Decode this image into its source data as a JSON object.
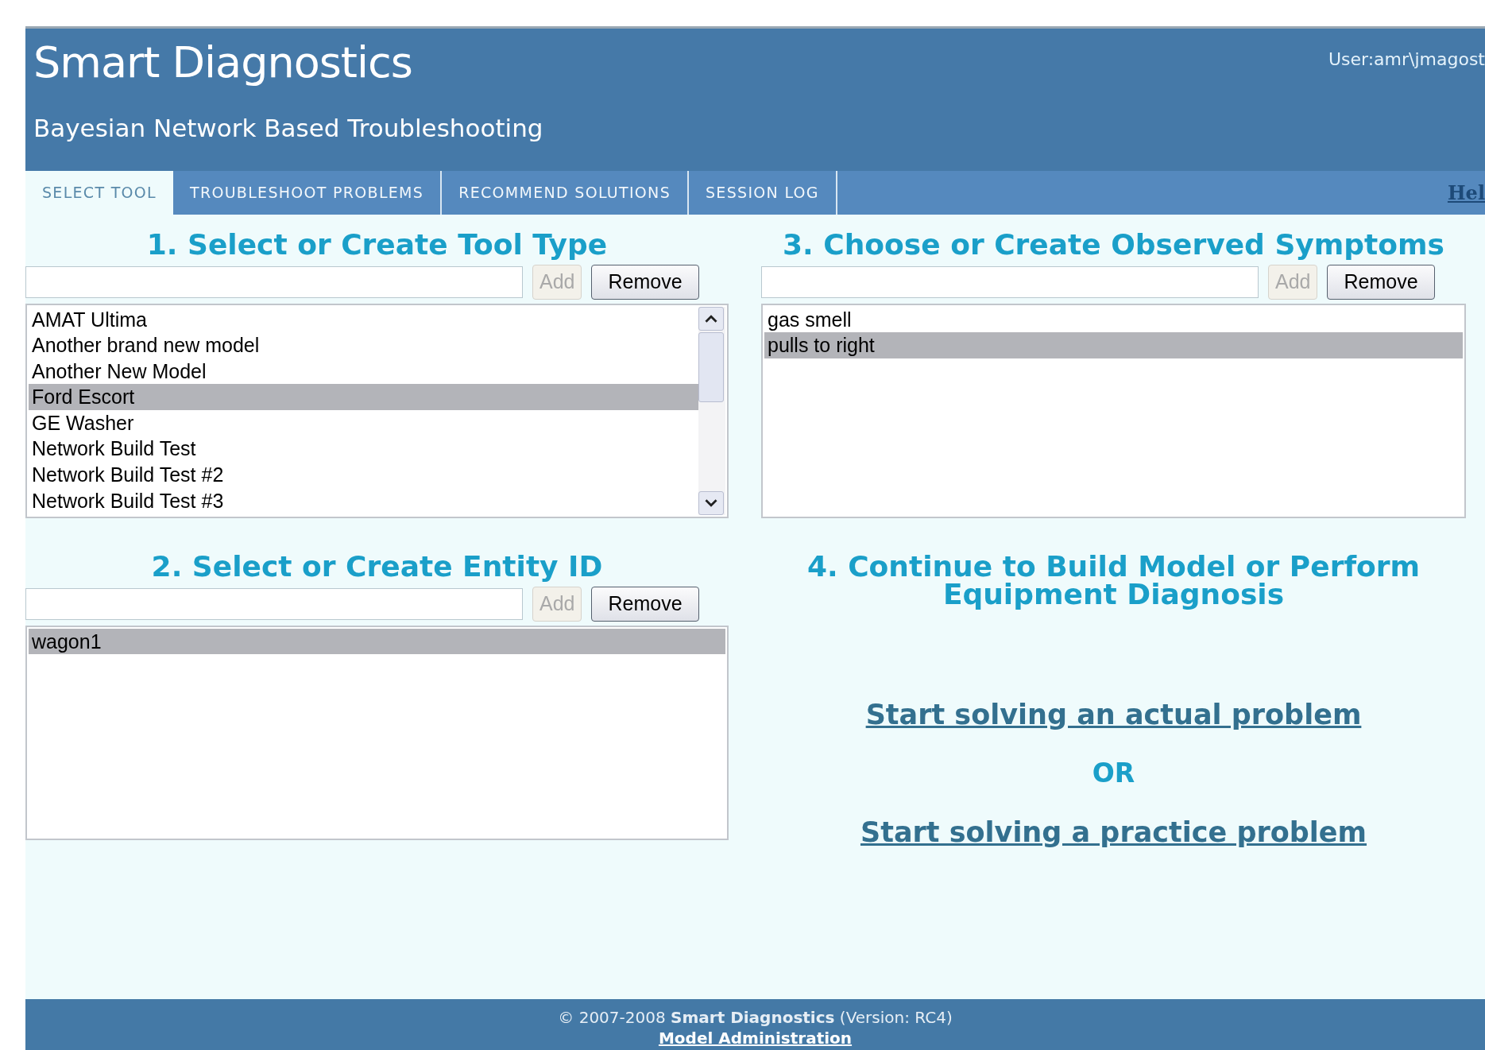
{
  "header": {
    "title": "Smart Diagnostics",
    "subtitle": "Bayesian Network Based Troubleshooting",
    "user": "User:amr\\jmagost"
  },
  "tabs": [
    {
      "label": "SELECT TOOL",
      "selected": true
    },
    {
      "label": "TROUBLESHOOT PROBLEMS",
      "selected": false
    },
    {
      "label": "RECOMMEND SOLUTIONS",
      "selected": false
    },
    {
      "label": "SESSION LOG",
      "selected": false
    }
  ],
  "help_link": "Hel",
  "panels": [
    {
      "kind": "picker",
      "heading": "1. Select or Create Tool Type",
      "add_button": {
        "label": "Add",
        "disabled": true
      },
      "remove_button": {
        "label": "Remove",
        "disabled": false
      },
      "scrollbar": true,
      "items": [
        {
          "label": "AMAT Ultima",
          "selected": false
        },
        {
          "label": "Another brand new model",
          "selected": false
        },
        {
          "label": "Another New Model",
          "selected": false
        },
        {
          "label": "Ford Escort",
          "selected": true
        },
        {
          "label": "GE Washer",
          "selected": false
        },
        {
          "label": "Network Build Test",
          "selected": false
        },
        {
          "label": "Network Build Test #2",
          "selected": false
        },
        {
          "label": "Network Build Test #3",
          "selected": false
        }
      ]
    },
    {
      "kind": "picker",
      "heading": "3. Choose or Create Observed Symptoms",
      "add_button": {
        "label": "Add",
        "disabled": true
      },
      "remove_button": {
        "label": "Remove",
        "disabled": false
      },
      "scrollbar": false,
      "items": [
        {
          "label": "gas smell",
          "selected": false
        },
        {
          "label": "pulls to right",
          "selected": true
        }
      ]
    },
    {
      "kind": "picker",
      "heading": "2. Select or Create Entity ID",
      "add_button": {
        "label": "Add",
        "disabled": true
      },
      "remove_button": {
        "label": "Remove",
        "disabled": false
      },
      "scrollbar": false,
      "items": [
        {
          "label": "wagon1",
          "selected": true
        }
      ]
    },
    {
      "kind": "actions",
      "heading": "4. Continue to Build Model or Perform Equipment Diagnosis",
      "links": [
        "Start solving an actual problem",
        "Start solving a practice problem"
      ],
      "separator": "OR"
    }
  ],
  "footer": {
    "copyright": "© 2007-2008",
    "link": "Smart Diagnostics",
    "version": "(Version: RC4)",
    "admin_link": "Model Administration"
  }
}
